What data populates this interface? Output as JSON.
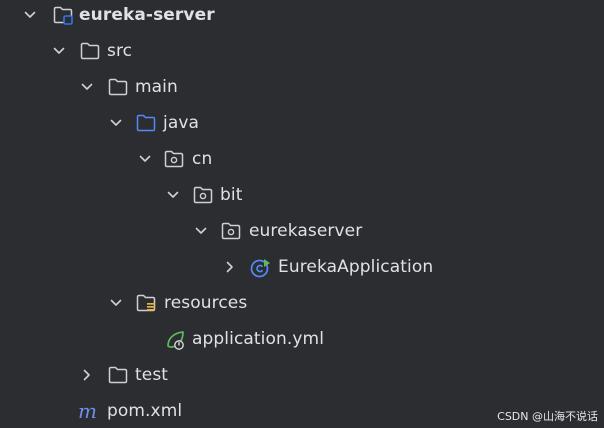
{
  "tree": {
    "items": [
      {
        "label": "eureka-server",
        "icon": "module-folder-icon",
        "expanded": true
      },
      {
        "label": "src",
        "icon": "folder-icon",
        "expanded": true
      },
      {
        "label": "main",
        "icon": "folder-icon",
        "expanded": true
      },
      {
        "label": "java",
        "icon": "source-root-folder-icon",
        "expanded": true
      },
      {
        "label": "cn",
        "icon": "package-icon",
        "expanded": true
      },
      {
        "label": "bit",
        "icon": "package-icon",
        "expanded": true
      },
      {
        "label": "eurekaserver",
        "icon": "package-icon",
        "expanded": true
      },
      {
        "label": "EurekaApplication",
        "icon": "spring-boot-class-icon",
        "expanded": false
      },
      {
        "label": "resources",
        "icon": "resources-folder-icon",
        "expanded": true
      },
      {
        "label": "application.yml",
        "icon": "spring-yml-icon"
      },
      {
        "label": "test",
        "icon": "folder-icon",
        "expanded": false
      },
      {
        "label": "pom.xml",
        "icon": "maven-icon"
      }
    ]
  },
  "watermark": {
    "text": "CSDN @山海不说话"
  },
  "colors": {
    "background": "#2b2d30",
    "text": "#dfe1e5",
    "icon_gray": "#ced0d6",
    "source_root_blue": "#548af7",
    "module_blue": "#3574f0",
    "spring_green": "#5fb85f",
    "maven_blue": "#6f8fe8",
    "resources_yellow": "#e3b341"
  }
}
